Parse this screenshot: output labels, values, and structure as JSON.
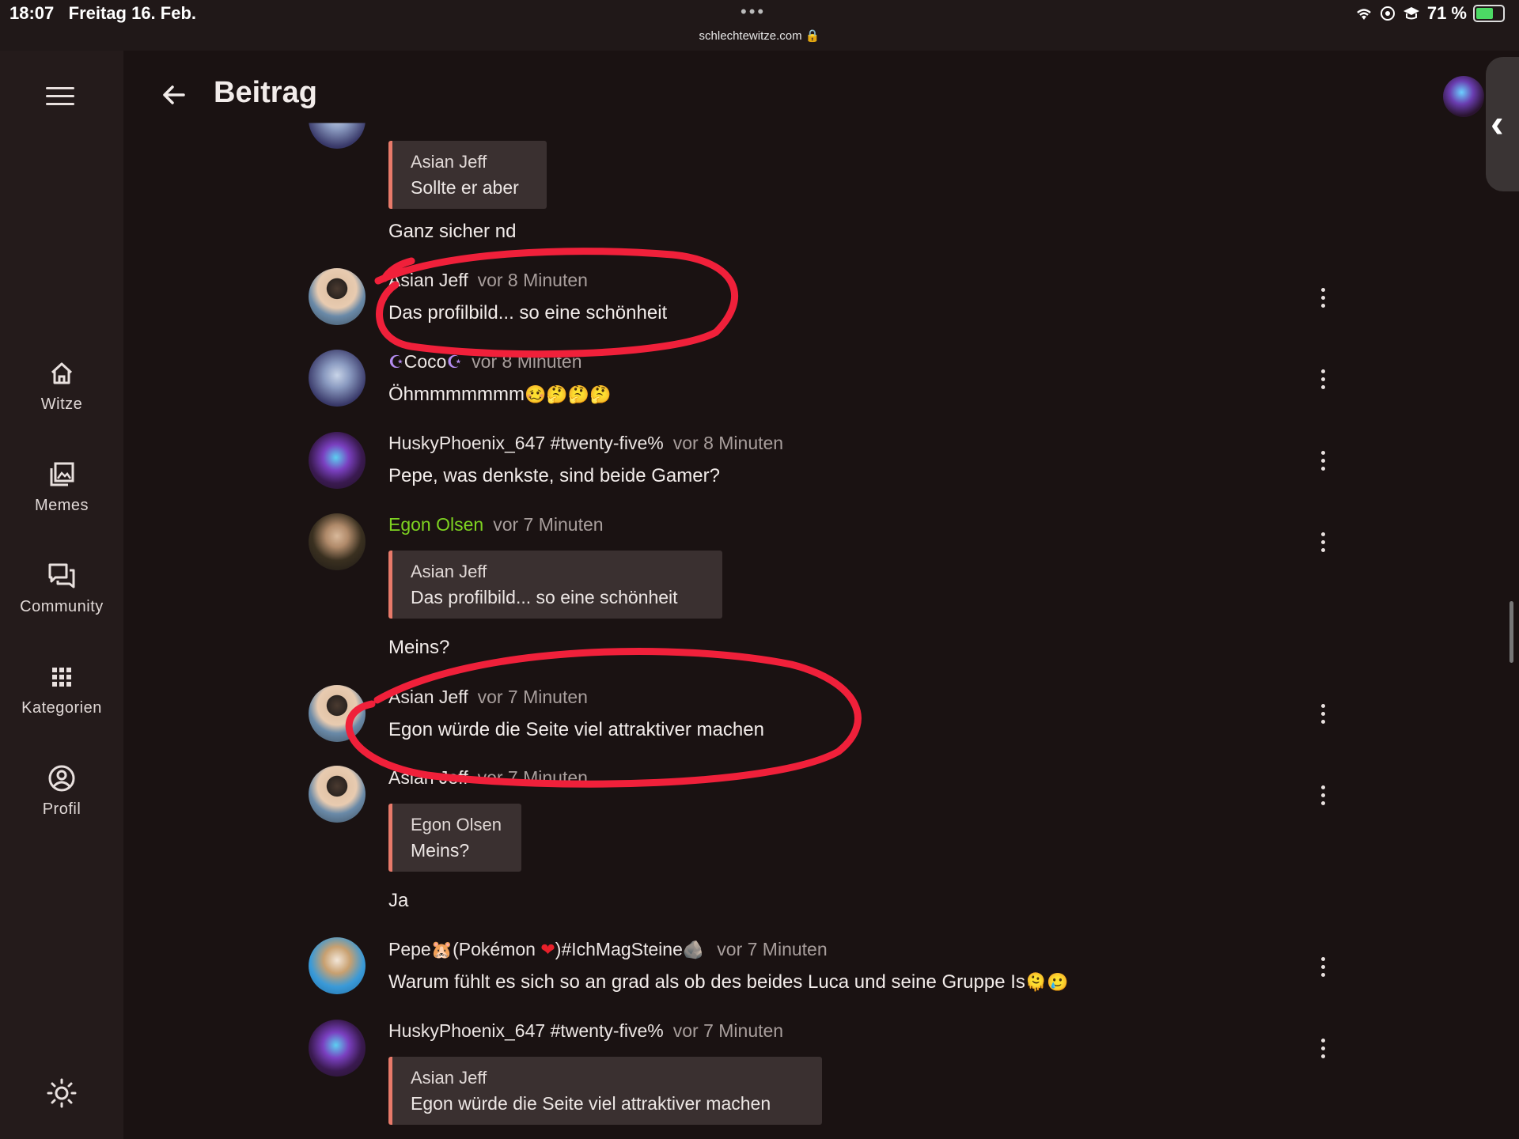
{
  "status_bar": {
    "time": "18:07",
    "date": "Freitag 16. Feb.",
    "dots": "•••",
    "url": "schlechtewitze.com 🔒",
    "battery": "71 %",
    "battery_level": 0.71
  },
  "header": {
    "title": "Beitrag"
  },
  "sidebar": {
    "items": [
      {
        "label": "Witze",
        "icon": "home-icon"
      },
      {
        "label": "Memes",
        "icon": "image-gallery-icon"
      },
      {
        "label": "Community",
        "icon": "chat-bubbles-icon"
      },
      {
        "label": "Kategorien",
        "icon": "grid-icon"
      },
      {
        "label": "Profil",
        "icon": "user-circle-icon"
      }
    ]
  },
  "comments": [
    {
      "author": "",
      "time": "",
      "quote_author": "Asian Jeff",
      "quote_text": "Sollte er aber",
      "text": "Ganz sicher nd"
    },
    {
      "author": "Asian Jeff",
      "time": "vor 8 Minuten",
      "text": "Das profilbild... so eine schönheit"
    },
    {
      "author": "Coco",
      "author_prefix": "☪",
      "author_suffix": "☪",
      "time": "vor 8 Minuten",
      "text": "Öhmmmmmmm",
      "text_emojis": "🥴🤔🤔🤔"
    },
    {
      "author": "HuskyPhoenix_647 #twenty-five%",
      "time": "vor 8 Minuten",
      "text": "Pepe, was denkste, sind beide Gamer?"
    },
    {
      "author": "Egon Olsen",
      "time": "vor 7 Minuten",
      "quote_author": "Asian Jeff",
      "quote_text": "Das profilbild... so eine schönheit",
      "text": "Meins?"
    },
    {
      "author": "Asian Jeff",
      "time": "vor 7 Minuten",
      "text": "Egon würde die Seite viel attraktiver machen"
    },
    {
      "author": "Asian Jeff",
      "time": "vor 7 Minuten",
      "quote_author": "Egon Olsen",
      "quote_text": "Meins?",
      "text": "Ja"
    },
    {
      "author_a": "Pepe",
      "author_emoji_a": "🐹",
      "author_b": "(Pokémon ",
      "author_emoji_b": "❤",
      "author_c": ")#IchMagSteine",
      "author_emoji_c": "🪨",
      "time": "vor 7 Minuten",
      "text": "Warum fühlt es sich so an grad als ob des beides Luca und seine Gruppe Is",
      "text_emojis": "🫠🥲"
    },
    {
      "author": "HuskyPhoenix_647 #twenty-five%",
      "time": "vor 7 Minuten",
      "quote_author": "Asian Jeff",
      "quote_text": "Egon würde die Seite viel attraktiver machen"
    }
  ],
  "colors": {
    "background": "#1a1212",
    "sidebar": "#241b1b",
    "quote_border": "#e87a6a",
    "green_author": "#7ed321",
    "annotation_red": "#f0203a"
  }
}
